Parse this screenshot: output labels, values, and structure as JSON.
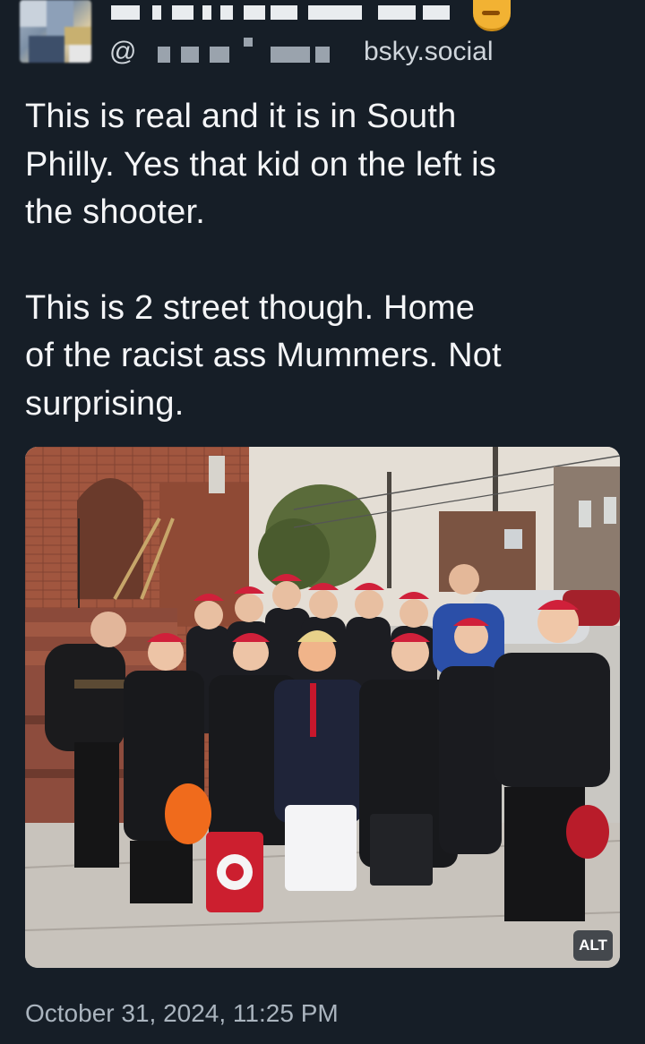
{
  "post": {
    "author": {
      "handle_prefix": "@",
      "handle_suffix": "bsky.social"
    },
    "text_paragraph_1": "This is real and it is in South\nPhilly. Yes that kid on the left is\nthe shooter.",
    "text_paragraph_2": "This is 2 street though. Home\nof the racist ass Mummers. Not\nsurprising.",
    "image": {
      "alt_label": "ALT"
    },
    "timestamp": "October 31, 2024, 11:25 PM"
  },
  "colors": {
    "background": "#161e27",
    "text": "#f4f5f7",
    "muted_text": "#aab4be",
    "hat_red": "#d0203a"
  },
  "icons": {
    "avatar": "avatar-image",
    "emoji": "emoji-icon"
  }
}
